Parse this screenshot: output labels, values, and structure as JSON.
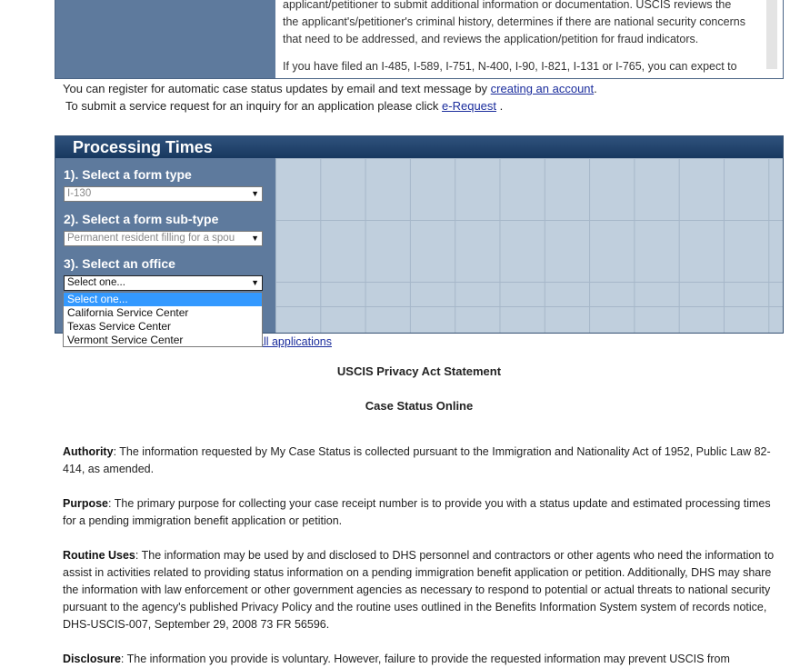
{
  "top_box": {
    "lines_1": [
      "applicant/petitioner to submit additional information or documentation. USCIS reviews the",
      "the applicant's/petitioner's criminal history, determines if there are national security concerns",
      "that need to be addressed, and reviews the application/petition for fraud indicators."
    ],
    "line_2": "If you have filed an I-485, I-589, I-751, N-400, I-90, I-821, I-131 or I-765, you can expect to"
  },
  "register_line": {
    "text": "You can register for automatic case status updates by email and text message by ",
    "link": "creating an account",
    "end": "."
  },
  "erequest_line": {
    "text": "To submit a service request for an inquiry for an application please click ",
    "link": "e-Request",
    "end": " ."
  },
  "processing": {
    "title": "Processing Times",
    "step1_label": "1). Select a form type",
    "step1_value": "I-130",
    "step2_label": "2). Select a form sub-type",
    "step2_value": "Permanent resident filling for a spou",
    "step3_label": "3). Select an office",
    "step3_value": "Select one...",
    "dropdown_options": [
      "Select one...",
      "California Service Center",
      "Texas Service Center",
      "Vermont Service Center"
    ],
    "below_link": "all applications"
  },
  "privacy": {
    "title": "USCIS Privacy Act Statement",
    "subtitle": "Case Status Online",
    "authority_label": "Authority",
    "authority_text": ": The information requested by My Case Status is collected pursuant to the Immigration and Nationality Act of 1952, Public Law 82-414, as amended.",
    "purpose_label": "Purpose",
    "purpose_text": ": The primary purpose for collecting your case receipt number is to provide you with a status update and estimated processing times for a pending immigration benefit application or petition.",
    "routine_label": "Routine Uses",
    "routine_text": ": The information may be used by and disclosed to DHS personnel and contractors or other agents who need the information to assist in activities related to providing status information on a pending immigration benefit application or petition. Additionally, DHS may share the information with law enforcement or other government agencies as necessary to respond to potential or actual threats to national security pursuant to the agency's published Privacy Policy and the routine uses outlined in the Benefits Information System system of records notice, DHS-USCIS-007, September 29, 2008 73 FR 56596.",
    "disclosure_label": "Disclosure",
    "disclosure_text": ": The information you provide is voluntary. However, failure to provide the requested information may prevent USCIS from"
  }
}
